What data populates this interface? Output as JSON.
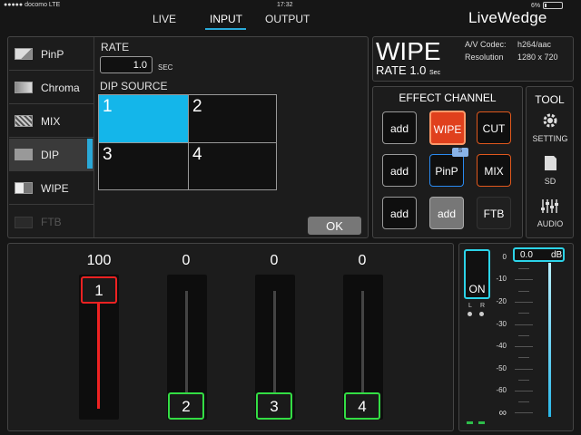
{
  "status_bar": {
    "carrier": "●●●●● docomo  LTE",
    "time": "17:32",
    "battery": "6%"
  },
  "tabs": [
    {
      "label": "LIVE"
    },
    {
      "label": "INPUT"
    },
    {
      "label": "OUTPUT"
    }
  ],
  "active_tab": "INPUT",
  "brand": "LiveWedge",
  "transitions": [
    {
      "label": "PinP"
    },
    {
      "label": "Chroma"
    },
    {
      "label": "MIX"
    },
    {
      "label": "DIP"
    },
    {
      "label": "WIPE"
    },
    {
      "label": "FTB"
    }
  ],
  "selected_transition": "DIP",
  "rate": {
    "label": "RATE",
    "value": "1.0",
    "unit": "SEC"
  },
  "dip_source": {
    "label": "DIP SOURCE",
    "cells": [
      "1",
      "2",
      "3",
      "4"
    ],
    "selected": "1"
  },
  "ok_label": "OK",
  "wipe_info": {
    "title": "WIPE",
    "rate_label": "RATE 1.0",
    "rate_unit": "Sec",
    "codec_label": "A/V Codec:",
    "codec_value": "h264/aac",
    "resolution_label": "Resolution",
    "resolution_value": "1280 x 720"
  },
  "effect_channel": {
    "title": "EFFECT CHANNEL",
    "rows": [
      [
        "add",
        "WIPE",
        "CUT"
      ],
      [
        "add",
        "PinP",
        "MIX"
      ],
      [
        "add",
        "add",
        "FTB"
      ]
    ],
    "badge": "S"
  },
  "tool": {
    "title": "TOOL",
    "items": [
      {
        "label": "SETTING",
        "icon": "gear-icon"
      },
      {
        "label": "SD",
        "icon": "sd-card-icon"
      },
      {
        "label": "AUDIO",
        "icon": "audio-mixer-icon"
      }
    ]
  },
  "faders": [
    {
      "channel": "1",
      "value": "100",
      "level": 1.0,
      "color": "#ee2222"
    },
    {
      "channel": "2",
      "value": "0",
      "level": 0.0,
      "color": "#33dd44"
    },
    {
      "channel": "3",
      "value": "0",
      "level": 0.0,
      "color": "#33dd44"
    },
    {
      "channel": "4",
      "value": "0",
      "level": 0.0,
      "color": "#33dd44"
    }
  ],
  "audio": {
    "on_label": "ON",
    "l_label": "L",
    "r_label": "R",
    "db_value": "0.0",
    "db_unit": "dB",
    "scale": [
      "0",
      "-10",
      "-20",
      "-30",
      "-40",
      "-50",
      "-60",
      "∞"
    ],
    "accent": "#2cd3e8"
  }
}
